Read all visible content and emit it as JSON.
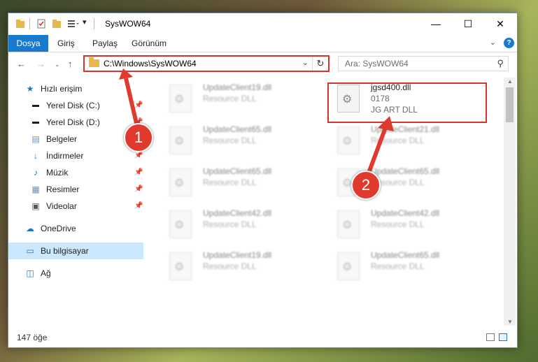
{
  "window": {
    "title": "SysWOW64"
  },
  "ribbon": {
    "tabs": [
      "Dosya",
      "Giriş",
      "Paylaş",
      "Görünüm"
    ]
  },
  "nav": {
    "address": "C:\\Windows\\SysWOW64",
    "search_placeholder": "Ara: SysWOW64"
  },
  "sidebar": {
    "items": [
      {
        "label": "Hızlı erişim",
        "icon": "star-icon"
      },
      {
        "label": "Yerel Disk (C:)",
        "icon": "drive-icon",
        "pinned": true
      },
      {
        "label": "Yerel Disk (D:)",
        "icon": "drive-icon",
        "pinned": true
      },
      {
        "label": "Belgeler",
        "icon": "documents-icon",
        "pinned": true
      },
      {
        "label": "İndirmeler",
        "icon": "download-icon",
        "pinned": true
      },
      {
        "label": "Müzik",
        "icon": "music-icon",
        "pinned": true
      },
      {
        "label": "Resimler",
        "icon": "pictures-icon",
        "pinned": true
      },
      {
        "label": "Videolar",
        "icon": "videos-icon",
        "pinned": true
      },
      {
        "label": "OneDrive",
        "icon": "cloud-icon"
      },
      {
        "label": "Bu bilgisayar",
        "icon": "computer-icon",
        "selected": true
      },
      {
        "label": "Ağ",
        "icon": "network-icon"
      }
    ]
  },
  "files": [
    {
      "name": "UpdateClient19.dll",
      "meta1": "Resource DLL",
      "meta2": ""
    },
    {
      "name": "jgsd400.dll",
      "meta1": "0178",
      "meta2": "JG ART DLL"
    },
    {
      "name": "UpdateClient65.dll",
      "meta1": "Resource DLL",
      "meta2": ""
    },
    {
      "name": "UpdateClient21.dll",
      "meta1": "Resource DLL",
      "meta2": ""
    },
    {
      "name": "UpdateClient65.dll",
      "meta1": "Resource DLL",
      "meta2": ""
    },
    {
      "name": "UpdateClient65.dll",
      "meta1": "Resource DLL",
      "meta2": ""
    },
    {
      "name": "UpdateClient42.dll",
      "meta1": "Resource DLL",
      "meta2": ""
    },
    {
      "name": "UpdateClient42.dll",
      "meta1": "Resource DLL",
      "meta2": ""
    },
    {
      "name": "UpdateClient19.dll",
      "meta1": "Resource DLL",
      "meta2": ""
    },
    {
      "name": "UpdateClient65.dll",
      "meta1": "Resource DLL",
      "meta2": ""
    }
  ],
  "status": {
    "item_count": "147 öğe"
  },
  "annotations": [
    "1",
    "2"
  ],
  "colors": {
    "accent": "#1979ca",
    "highlight": "#d9312b",
    "selection": "#cce8ff"
  }
}
